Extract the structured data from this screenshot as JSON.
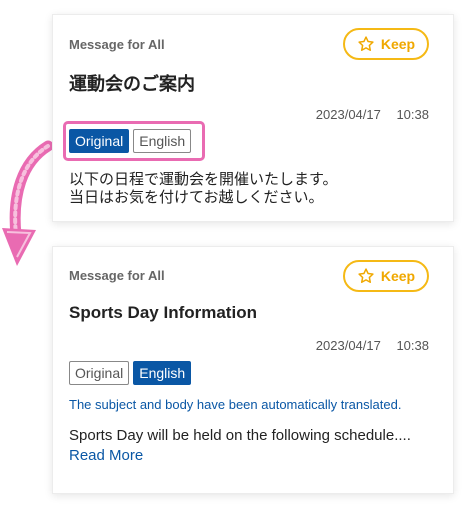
{
  "cards": [
    {
      "label": "Message for All",
      "keep_label": "Keep",
      "subject": "運動会のご案内",
      "timestamp": "2023/04/17 10:38",
      "lang_original": "Original",
      "lang_english": "English",
      "selected_language": "Original",
      "body_line1": "以下の日程で運動会を開催いたします。",
      "body_line2": "当日はお気を付けてお越しください。"
    },
    {
      "label": "Message for All",
      "keep_label": "Keep",
      "subject": "Sports Day Information",
      "timestamp": "2023/04/17 10:38",
      "lang_original": "Original",
      "lang_english": "English",
      "selected_language": "English",
      "translated_note": "The subject and body have been automatically translated.",
      "body_line1": "Sports Day will be held on the following schedule....",
      "read_more": "Read More"
    }
  ],
  "icons": {
    "keep": "star-outline-icon",
    "arrow": "curved-arrow-icon"
  },
  "colors": {
    "accent_blue": "#0a57a5",
    "keep_yellow": "#f5b915",
    "highlight_pink": "#e96bb2"
  }
}
